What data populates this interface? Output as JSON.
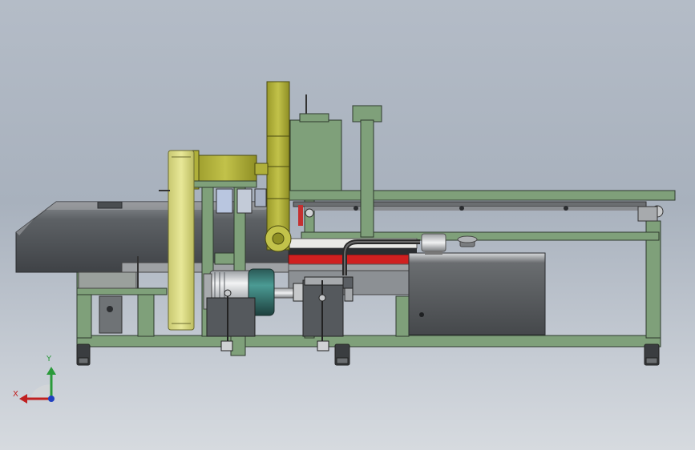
{
  "viewport": {
    "background_top": "#b4bcc7",
    "background_bottom": "#d6dadf"
  },
  "colors": {
    "frame_green": "#7fa07a",
    "frame_edge": "#2f3a2f",
    "belt_yellow": "#d8d880",
    "olive_yellow": "#b0b03a",
    "housing_dark": "#5a5e63",
    "motor_teal": "#2f6d6a",
    "conveyor_red": "#d02020"
  },
  "triad": {
    "x_label": "X",
    "y_label": "Y",
    "x_color": "#c02020",
    "y_color": "#2a9a3a",
    "z_color": "#2040c0"
  },
  "icons": [
    "axis-triad-icon"
  ]
}
